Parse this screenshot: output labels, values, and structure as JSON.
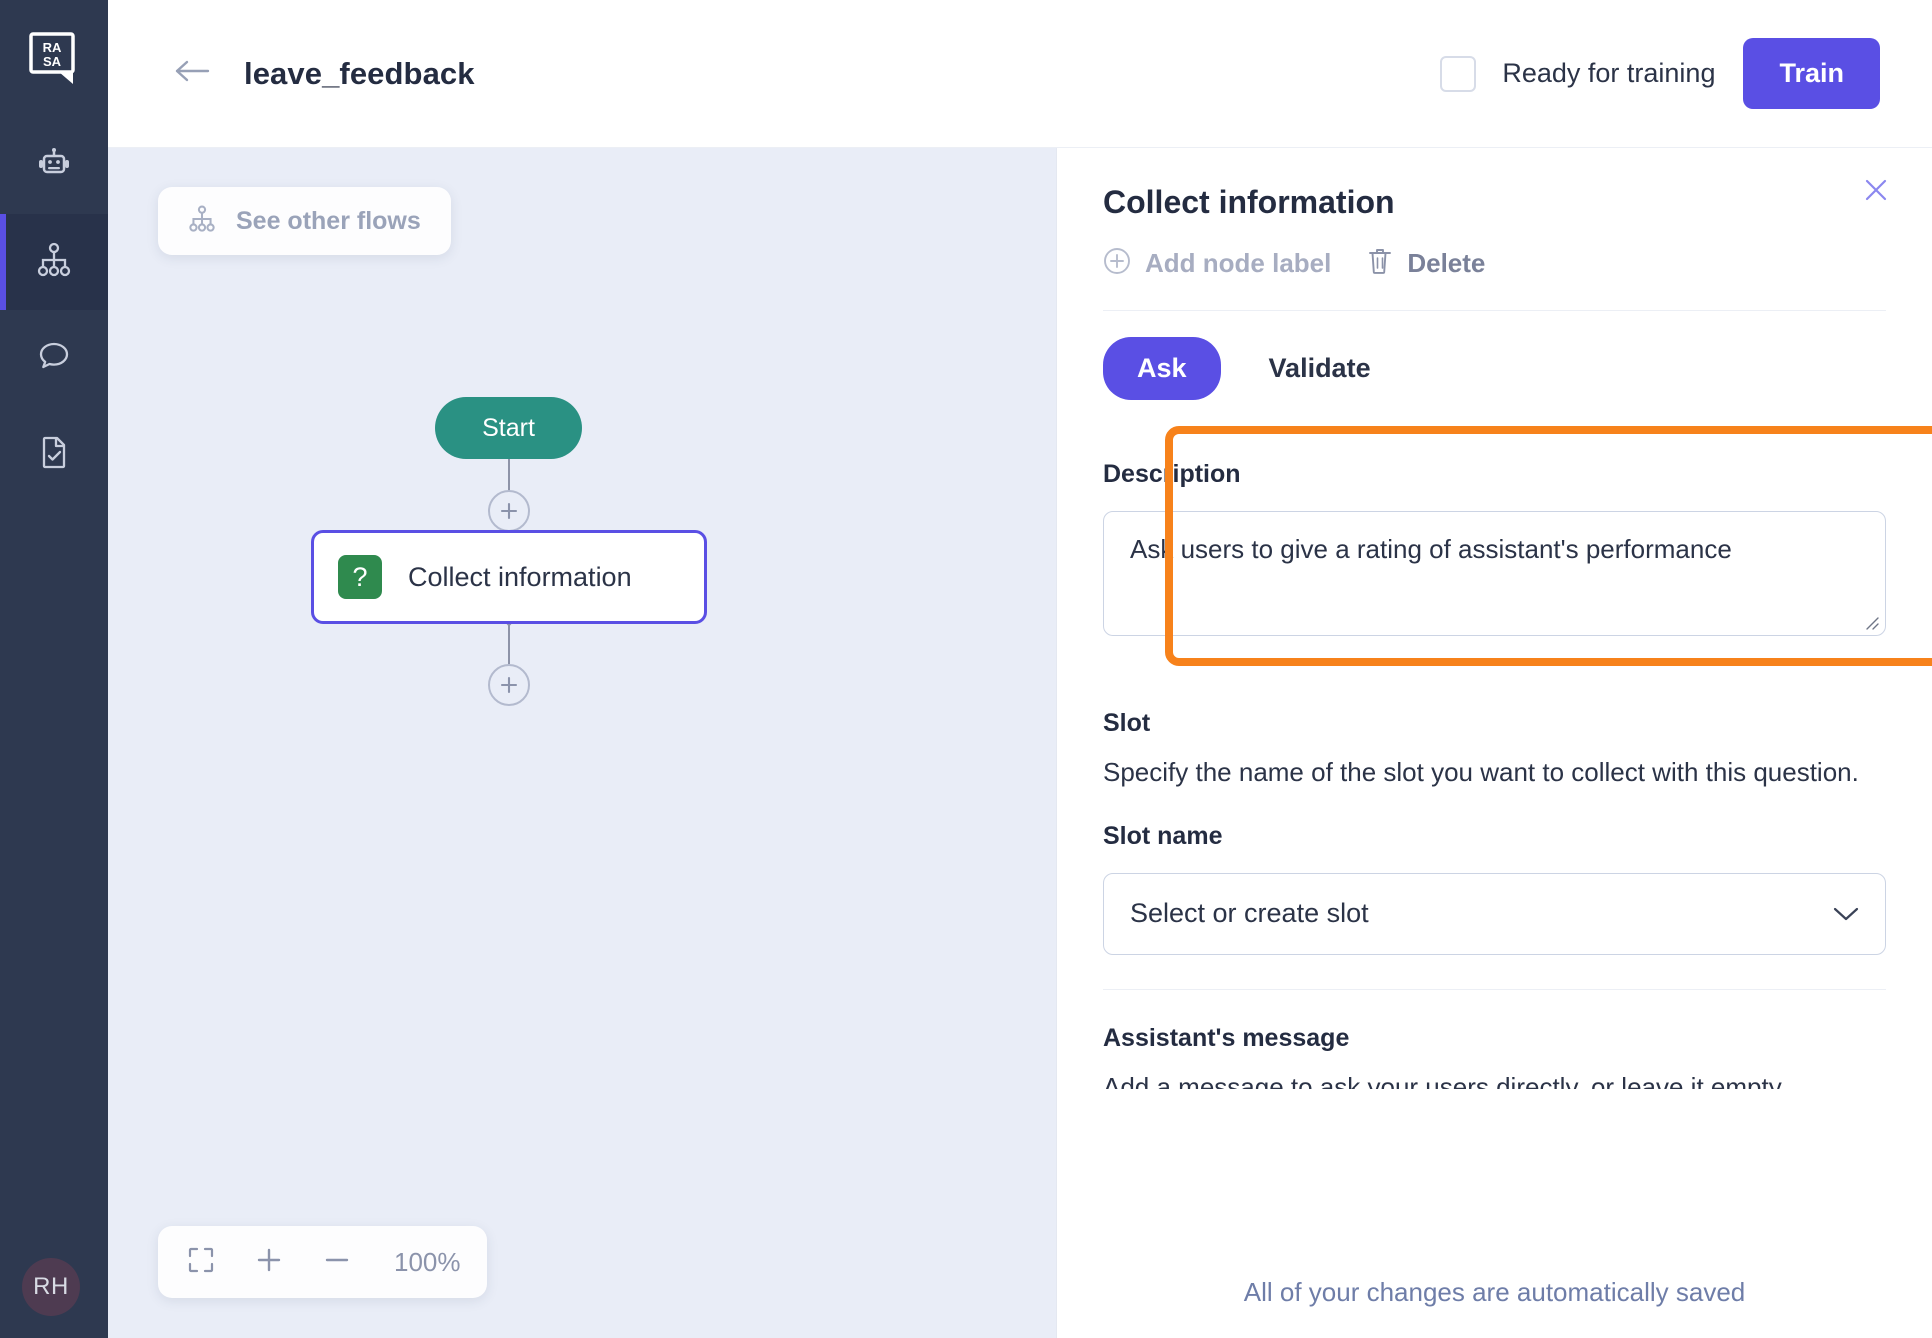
{
  "brand": {
    "logo_text": "RASA",
    "accent": "#5a4fe4",
    "rail_bg": "#2e3950",
    "start_node_color": "#2a9183",
    "highlight_color": "#f7821b"
  },
  "rail": {
    "items": [
      {
        "icon": "robot-icon",
        "name": "assistant",
        "active": false
      },
      {
        "icon": "flows-icon",
        "name": "flows",
        "active": true
      },
      {
        "icon": "chat-bubble-icon",
        "name": "conversations",
        "active": false
      },
      {
        "icon": "document-check-icon",
        "name": "tests",
        "active": false
      }
    ],
    "avatar_initials": "RH"
  },
  "topbar": {
    "back_icon": "arrow-left-icon",
    "title": "leave_feedback",
    "ready_checkbox_label": "Ready for training",
    "ready_checkbox_checked": false,
    "train_label": "Train"
  },
  "canvas": {
    "see_other_flows_label": "See other flows",
    "see_other_flows_icon": "flows-icon",
    "nodes": [
      {
        "type": "start",
        "label": "Start"
      },
      {
        "type": "collect",
        "label": "Collect information",
        "badge": "?"
      }
    ],
    "add_buttons": [
      {
        "name": "add-step-above",
        "icon": "plus-icon"
      },
      {
        "name": "add-step-below",
        "icon": "plus-icon"
      }
    ],
    "zoom": {
      "fit_icon": "fit-screen-icon",
      "zoom_in_icon": "plus-icon",
      "zoom_out_icon": "minus-icon",
      "level": "100%"
    }
  },
  "panel": {
    "title": "Collect information",
    "close_icon": "close-icon",
    "actions": [
      {
        "icon": "plus-circle-icon",
        "label": "Add node label",
        "state": "muted"
      },
      {
        "icon": "trash-icon",
        "label": "Delete",
        "state": "dark"
      }
    ],
    "tabs": [
      {
        "label": "Ask",
        "active": true
      },
      {
        "label": "Validate",
        "active": false
      }
    ],
    "description": {
      "label": "Description",
      "value": "Ask users to give a rating of assistant's performance",
      "placeholder": ""
    },
    "slot": {
      "label": "Slot",
      "helper": "Specify the name of the slot you want to collect with this question.",
      "name_label": "Slot name",
      "select_value": "Select or create slot",
      "chevron_icon": "chevron-down-icon"
    },
    "assistant_message": {
      "label": "Assistant's message",
      "helper_clipped": "Add a message to ask your users directly, or leave it empty."
    },
    "save_note": "All of your changes are automatically saved"
  }
}
